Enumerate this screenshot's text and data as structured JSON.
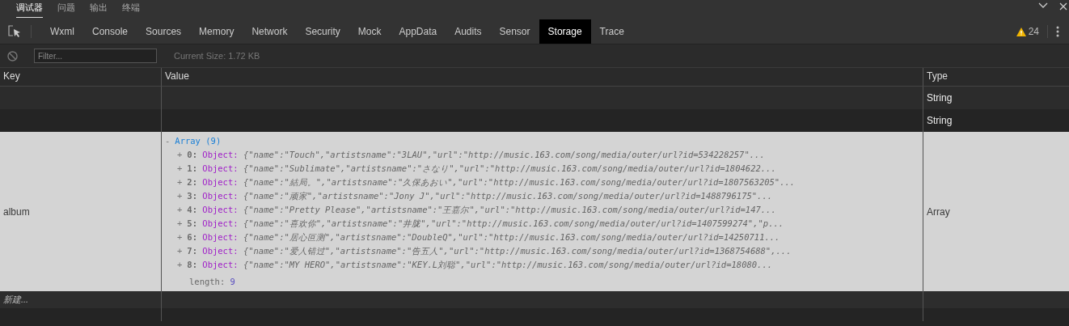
{
  "top_tabs": [
    {
      "label": "调试器",
      "selected": true
    },
    {
      "label": "问题",
      "selected": false
    },
    {
      "label": "输出",
      "selected": false
    },
    {
      "label": "终端",
      "selected": false
    }
  ],
  "panel_tabs": [
    {
      "label": "Wxml",
      "selected": false
    },
    {
      "label": "Console",
      "selected": false
    },
    {
      "label": "Sources",
      "selected": false
    },
    {
      "label": "Memory",
      "selected": false
    },
    {
      "label": "Network",
      "selected": false
    },
    {
      "label": "Security",
      "selected": false
    },
    {
      "label": "Mock",
      "selected": false
    },
    {
      "label": "AppData",
      "selected": false
    },
    {
      "label": "Audits",
      "selected": false
    },
    {
      "label": "Sensor",
      "selected": false
    },
    {
      "label": "Storage",
      "selected": true
    },
    {
      "label": "Trace",
      "selected": false
    }
  ],
  "warnings": "24",
  "filter": {
    "placeholder": "Filter..."
  },
  "current_size": "Current Size: 1.72 KB",
  "table": {
    "columns": [
      "Key",
      "Value",
      "Type"
    ],
    "rows": [
      {
        "type": "String",
        "selected": false
      },
      {
        "type": "String",
        "selected": false
      },
      {
        "key": "album",
        "type": "Array",
        "selected": true,
        "value": {
          "toggle": "-",
          "summary": "Array (9)",
          "items": [
            {
              "toggle": "+",
              "index": "0:",
              "label": "Object:",
              "preview": "{\"name\":\"Touch\",\"artistsname\":\"3LAU\",\"url\":\"http://music.163.com/song/media/outer/url?id=534228257\"..."
            },
            {
              "toggle": "+",
              "index": "1:",
              "label": "Object:",
              "preview": "{\"name\":\"Sublimate\",\"artistsname\":\"さなり\",\"url\":\"http://music.163.com/song/media/outer/url?id=1804622..."
            },
            {
              "toggle": "+",
              "index": "2:",
              "label": "Object:",
              "preview": "{\"name\":\"結局。\",\"artistsname\":\"久保あおい\",\"url\":\"http://music.163.com/song/media/outer/url?id=1807563205\"..."
            },
            {
              "toggle": "+",
              "index": "3:",
              "label": "Object:",
              "preview": "{\"name\":\"顽家\",\"artistsname\":\"Jony J\",\"url\":\"http://music.163.com/song/media/outer/url?id=1488796175\"..."
            },
            {
              "toggle": "+",
              "index": "4:",
              "label": "Object:",
              "preview": "{\"name\":\"Pretty Please\",\"artistsname\":\"王嘉尔\",\"url\":\"http://music.163.com/song/media/outer/url?id=147..."
            },
            {
              "toggle": "+",
              "index": "5:",
              "label": "Object:",
              "preview": "{\"name\":\"喜欢你\",\"artistsname\":\"井胧\",\"url\":\"http://music.163.com/song/media/outer/url?id=1407599274\",\"p..."
            },
            {
              "toggle": "+",
              "index": "6:",
              "label": "Object:",
              "preview": "{\"name\":\"居心叵测\",\"artistsname\":\"DoubleQ\",\"url\":\"http://music.163.com/song/media/outer/url?id=14250711..."
            },
            {
              "toggle": "+",
              "index": "7:",
              "label": "Object:",
              "preview": "{\"name\":\"爱人错过\",\"artistsname\":\"告五人\",\"url\":\"http://music.163.com/song/media/outer/url?id=1368754688\",..."
            },
            {
              "toggle": "+",
              "index": "8:",
              "label": "Object:",
              "preview": "{\"name\":\"MY HERO\",\"artistsname\":\"KEY.L刘聪\",\"url\":\"http://music.163.com/song/media/outer/url?id=18080..."
            }
          ],
          "length_label": "length:",
          "length": "9"
        }
      }
    ],
    "new_row": "新建..."
  }
}
